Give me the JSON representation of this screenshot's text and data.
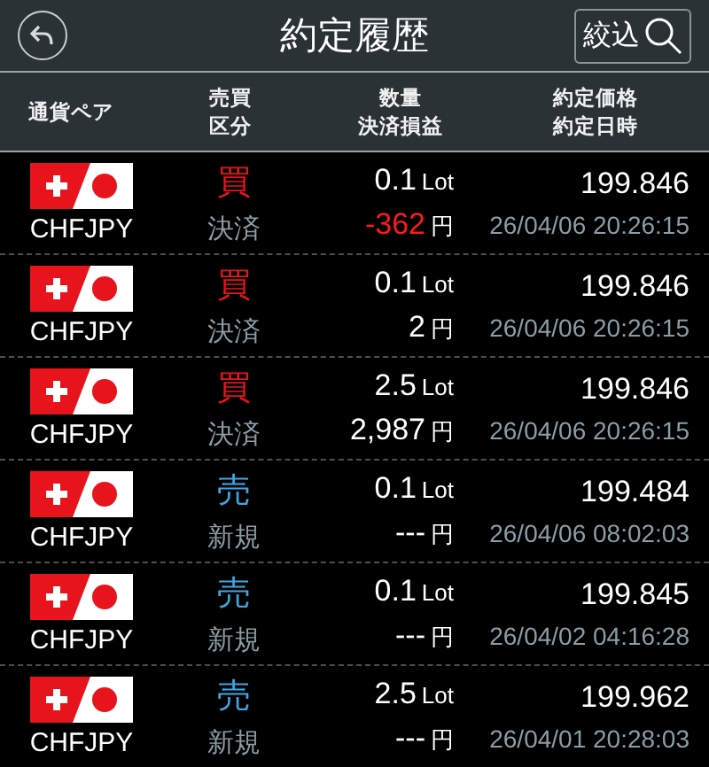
{
  "header": {
    "title": "約定履歴",
    "filter_button": "絞込"
  },
  "columns": [
    {
      "lines": [
        "通貨ペア"
      ]
    },
    {
      "lines": [
        "売買",
        "区分"
      ]
    },
    {
      "lines": [
        "数量",
        "決済損益"
      ]
    },
    {
      "lines": [
        "約定価格",
        "約定日時"
      ]
    }
  ],
  "rows": [
    {
      "pair": "CHFJPY",
      "side": "買",
      "kind": "buy",
      "type": "決済",
      "quantity": "0.1",
      "quantity_unit": "Lot",
      "pnl": "-362",
      "pnl_negative": true,
      "pnl_unit": "円",
      "price": "199.846",
      "datetime": "26/04/06 20:26:15"
    },
    {
      "pair": "CHFJPY",
      "side": "買",
      "kind": "buy",
      "type": "決済",
      "quantity": "0.1",
      "quantity_unit": "Lot",
      "pnl": "2",
      "pnl_negative": false,
      "pnl_unit": "円",
      "price": "199.846",
      "datetime": "26/04/06 20:26:15"
    },
    {
      "pair": "CHFJPY",
      "side": "買",
      "kind": "buy",
      "type": "決済",
      "quantity": "2.5",
      "quantity_unit": "Lot",
      "pnl": "2,987",
      "pnl_negative": false,
      "pnl_unit": "円",
      "price": "199.846",
      "datetime": "26/04/06 20:26:15"
    },
    {
      "pair": "CHFJPY",
      "side": "売",
      "kind": "sell",
      "type": "新規",
      "quantity": "0.1",
      "quantity_unit": "Lot",
      "pnl": "---",
      "pnl_negative": false,
      "pnl_unit": "円",
      "price": "199.484",
      "datetime": "26/04/06 08:02:03"
    },
    {
      "pair": "CHFJPY",
      "side": "売",
      "kind": "sell",
      "type": "新規",
      "quantity": "0.1",
      "quantity_unit": "Lot",
      "pnl": "---",
      "pnl_negative": false,
      "pnl_unit": "円",
      "price": "199.845",
      "datetime": "26/04/02 04:16:28"
    },
    {
      "pair": "CHFJPY",
      "side": "売",
      "kind": "sell",
      "type": "新規",
      "quantity": "2.5",
      "quantity_unit": "Lot",
      "pnl": "---",
      "pnl_negative": false,
      "pnl_unit": "円",
      "price": "199.962",
      "datetime": "26/04/01 20:28:03"
    }
  ]
}
